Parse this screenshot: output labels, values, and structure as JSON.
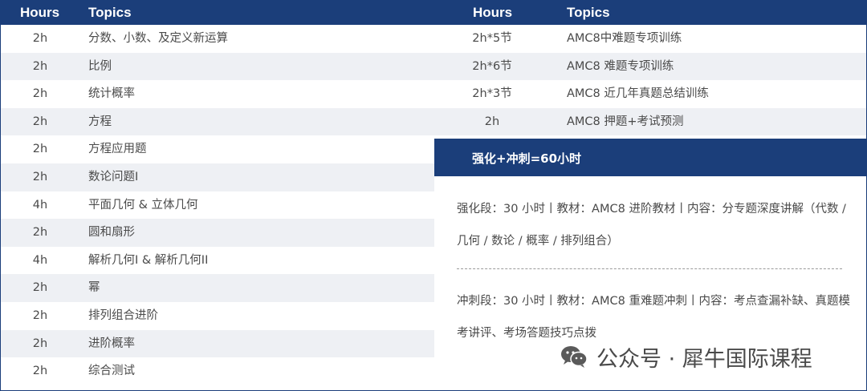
{
  "header": {
    "left_hours": "Hours",
    "left_topics": "Topics",
    "right_hours": "Hours",
    "right_topics": "Topics"
  },
  "left_rows": [
    {
      "hours": "2h",
      "topic": "分数、小数、及定义新运算"
    },
    {
      "hours": "2h",
      "topic": "比例"
    },
    {
      "hours": "2h",
      "topic": "统计概率"
    },
    {
      "hours": "2h",
      "topic": "方程"
    },
    {
      "hours": "2h",
      "topic": "方程应用题"
    },
    {
      "hours": "2h",
      "topic": "数论问题I"
    },
    {
      "hours": "4h",
      "topic": "平面几何 & 立体几何"
    },
    {
      "hours": "2h",
      "topic": "圆和扇形"
    },
    {
      "hours": "4h",
      "topic": "解析几何I & 解析几何II"
    },
    {
      "hours": "2h",
      "topic": "幂"
    },
    {
      "hours": "2h",
      "topic": "排列组合进阶"
    },
    {
      "hours": "2h",
      "topic": "进阶概率"
    },
    {
      "hours": "2h",
      "topic": "综合测试"
    }
  ],
  "right_rows": [
    {
      "hours": "2h*5节",
      "topic": "AMC8中难题专项训练"
    },
    {
      "hours": "2h*6节",
      "topic": "AMC8 难题专项训练"
    },
    {
      "hours": "2h*3节",
      "topic": "AMC8 近几年真题总结训练"
    },
    {
      "hours": "2h",
      "topic": "AMC8 押题+考试预测"
    }
  ],
  "summary": {
    "band_title": "强化+冲刺=60小时",
    "para1": "强化段：30 小时丨教材：AMC8 进阶教材丨内容：分专题深度讲解（代数 / 几何 / 数论 / 概率 / 排列组合）",
    "para2": "冲刺段：30 小时丨教材：AMC8 重难题冲刺丨内容：考点查漏补缺、真题模考讲评、考场答题技巧点拨"
  },
  "watermark": {
    "icon": "wechat-icon",
    "text": "公众号 · 犀牛国际课程"
  },
  "colors": {
    "header_bg": "#1b3e7a",
    "row_shade": "#eef0f4",
    "text": "#4a4a4a"
  }
}
